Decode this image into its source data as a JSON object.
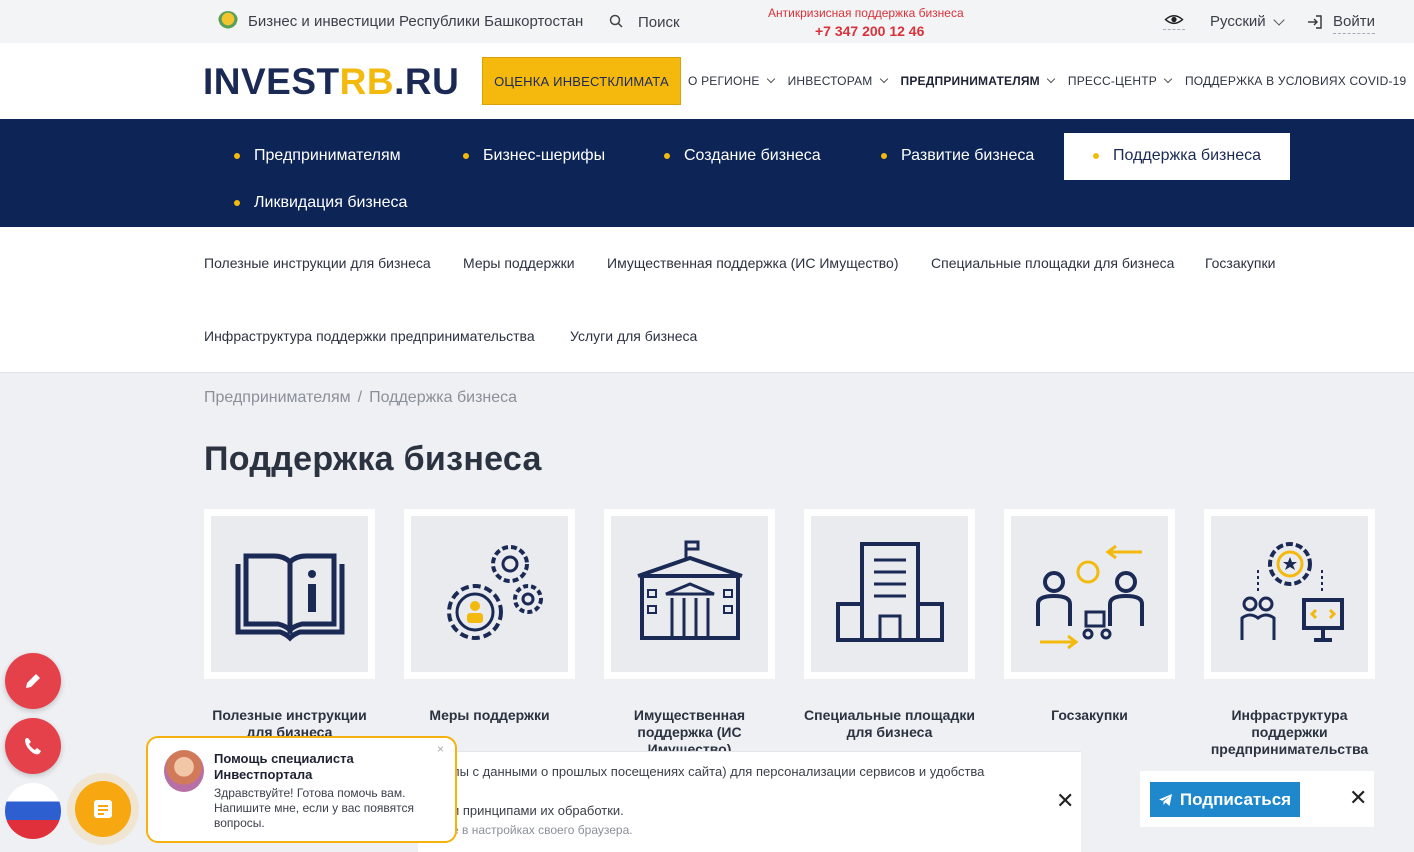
{
  "topbar": {
    "title": "Бизнес и инвестиции Республики Башкортостан",
    "search_label": "Поиск",
    "promo": "Антикризисная поддержка бизнеса",
    "phone": "+7 347 200 12 46",
    "language": "Русский",
    "login": "Войти"
  },
  "header": {
    "logo_main": "INVEST",
    "logo_accent": "RB",
    "logo_tail": ".RU",
    "cta": "ОЦЕНКА ИНВЕСТКЛИМАТА",
    "nav": [
      {
        "label": "О РЕГИОНЕ"
      },
      {
        "label": "ИНВЕСТОРАМ"
      },
      {
        "label": "ПРЕДПРИНИМАТЕЛЯМ"
      },
      {
        "label": "ПРЕСС-ЦЕНТР"
      },
      {
        "label": "ПОДДЕРЖКА В УСЛОВИЯХ COVID-19"
      }
    ]
  },
  "subnav": [
    {
      "label": "Предпринимателям"
    },
    {
      "label": "Бизнес-шерифы"
    },
    {
      "label": "Создание бизнеса"
    },
    {
      "label": "Развитие бизнеса"
    },
    {
      "label": "Поддержка бизнеса"
    },
    {
      "label": "Ликвидация бизнеса"
    }
  ],
  "sublinks": [
    {
      "label": "Полезные инструкции для бизнеса"
    },
    {
      "label": "Меры поддержки"
    },
    {
      "label": "Имущественная поддержка (ИС Имущество)"
    },
    {
      "label": "Специальные площадки для бизнеса"
    },
    {
      "label": "Госзакупки"
    },
    {
      "label": "Инфраструктура поддержки предпринимательства"
    },
    {
      "label": "Услуги для бизнеса"
    }
  ],
  "breadcrumb": {
    "parent": "Предпринимателям",
    "separator": "/",
    "current": "Поддержка бизнеса"
  },
  "page_title": "Поддержка бизнеса",
  "cards": [
    {
      "label": "Полезные инструкции для бизнеса",
      "icon": "book-info-icon"
    },
    {
      "label": "Меры поддержки",
      "icon": "gears-person-icon"
    },
    {
      "label": "Имущественная поддержка (ИС Имущество)",
      "icon": "government-building-icon"
    },
    {
      "label": "Специальные площадки для бизнеса",
      "icon": "office-building-icon"
    },
    {
      "label": "Госзакупки",
      "icon": "procurement-icon"
    },
    {
      "label": "Инфраструктура поддержки предпринимательства",
      "icon": "infrastructure-icon"
    }
  ],
  "cookie": {
    "line1": "лы с данными о прошлых посещениях сайта) для персонализации сервисов и удобства",
    "line2": "и принципами их обработки.",
    "line3": "е в настройках своего браузера."
  },
  "subscribe": {
    "label": "Подписаться"
  },
  "chat": {
    "title": "Помощь специалиста Инвестпортала",
    "text": "Здравствуйте! Готова помочь вам. Напишите мне, если у вас появятся вопросы.",
    "close": "×"
  },
  "colors": {
    "navy": "#0c2456",
    "accent_yellow": "#f3b90c",
    "red": "#e5414b",
    "subscribe_blue": "#1f88cc"
  }
}
